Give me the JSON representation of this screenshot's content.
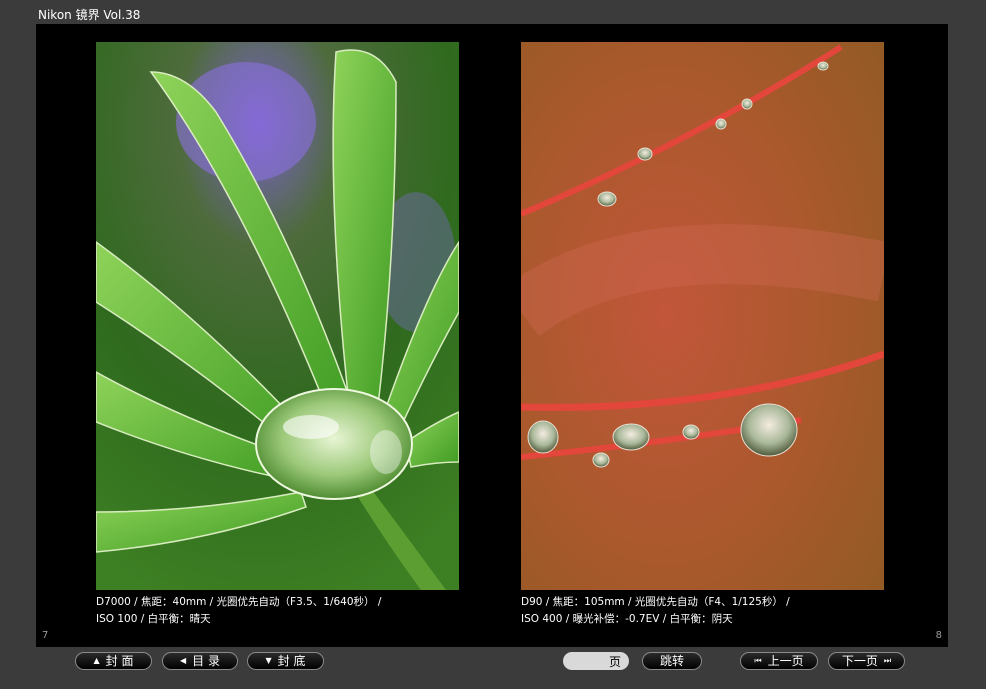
{
  "window": {
    "title": "Nikon 镜界 Vol.38"
  },
  "pages": {
    "left": {
      "page_number": "7",
      "caption_line1": "D7000 / 焦距：40mm / 光圈优先自动（F3.5、1/640秒） /",
      "caption_line2": "ISO 100 / 白平衡：晴天"
    },
    "right": {
      "page_number": "8",
      "caption_line1": "D90 / 焦距：105mm / 光圈优先自动（F4、1/125秒） /",
      "caption_line2": "ISO 400 / 曝光补偿：-0.7EV / 白平衡：阴天"
    }
  },
  "toolbar": {
    "cover_label": "封  面",
    "cover_icon": "▲",
    "toc_label": "目  录",
    "toc_icon": "◀",
    "back_label": "封  底",
    "back_icon": "▼",
    "page_input_suffix": "页",
    "goto_label": "跳转",
    "prev_label": "上一页",
    "prev_icon": "⏮",
    "next_label": "下一页",
    "next_icon": "⏭"
  }
}
